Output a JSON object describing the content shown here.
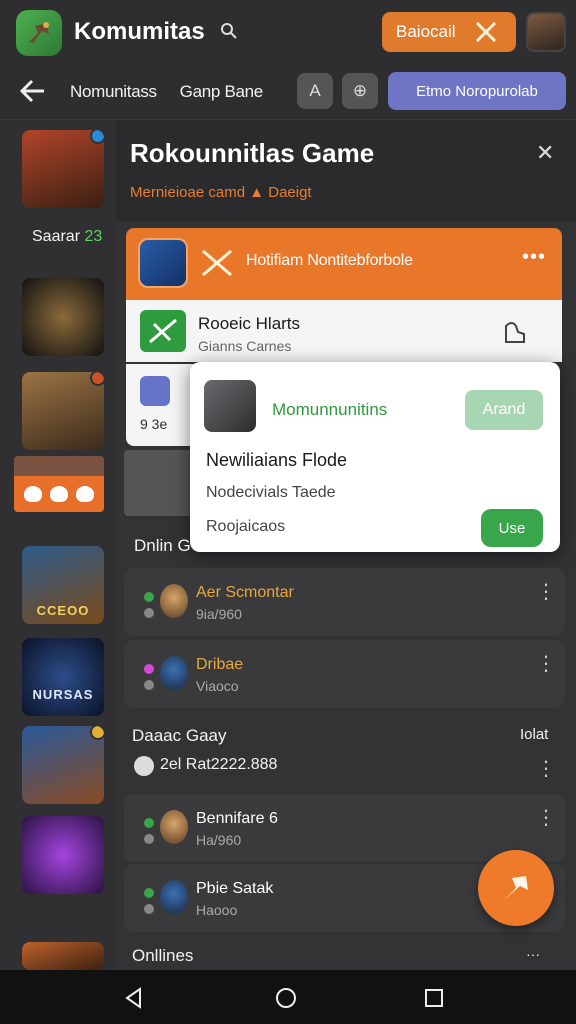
{
  "header": {
    "title": "Komumitas",
    "action_label": "Baiocail",
    "logo_icon": "game-logo-icon",
    "search_icon": "search-icon",
    "avatar": "user-avatar"
  },
  "nav": {
    "breadcrumb_1": "Nomunitass",
    "breadcrumb_2": "Ganp Bane",
    "icon_1": "A",
    "icon_2": "⊕",
    "pill_label": "Etmo Noropurolab"
  },
  "sidebar": {
    "label_prefix": "Saarar",
    "label_count": "23",
    "thumb_text_1": "CCEOO",
    "thumb_text_2": "NURSAS"
  },
  "main": {
    "title": "Rokounnitlas Game",
    "subtitle": "Mernieioae camd ▲ Daeigt",
    "card_title": "Hotifiam Nontitebforbole",
    "card_dots": "•••",
    "row_title": "Rooeic Hlarts",
    "row_sub": "Gianns Carnes",
    "row2_text": "9 3e",
    "section_online": "Dnlin G",
    "section_dabac": "Daaac Gaay",
    "section_dabac_right": "Iolat",
    "stat_line": "2el   Rat2222.888",
    "section_onlines": "Onllines",
    "section_onlines_right": "···"
  },
  "popup": {
    "title": "Momunnunitins",
    "btn_add": "Arand",
    "heading": "Newiliaians Flode",
    "line_1": "Nodecivials Taede",
    "line_2": "Roojaicaos",
    "btn_use": "Use"
  },
  "rows": [
    {
      "name": "Aer Scmontar",
      "sub": "9ia/960",
      "dot_top": "#3aa64b",
      "dot_bottom": "#888888",
      "name_color": "#e8a83a"
    },
    {
      "name": "Dribae",
      "sub": "Viaoco",
      "dot_top": "#d34ad3",
      "dot_bottom": "#888888",
      "name_color": "#e8a83a"
    },
    {
      "name": "Bennifare 6",
      "sub": "Ha/960",
      "dot_top": "#3aa64b",
      "dot_bottom": "#888888",
      "name_color": "#ffffff"
    },
    {
      "name": "Pbie Satak",
      "sub": "Haooo",
      "dot_top": "#3aa64b",
      "dot_bottom": "#888888",
      "name_color": "#ffffff"
    }
  ],
  "colors": {
    "accent_orange": "#e8772a",
    "accent_green": "#3aa64b",
    "accent_blue": "#6e75c4"
  }
}
